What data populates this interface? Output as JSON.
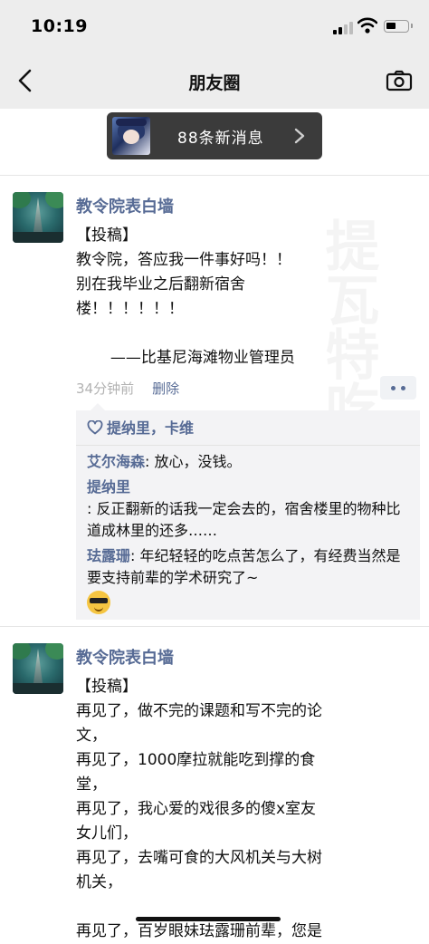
{
  "status_bar": {
    "time": "10:19"
  },
  "nav": {
    "title": "朋友圈"
  },
  "banner": {
    "text": "88条新消息"
  },
  "posts": [
    {
      "name": "教令院表白墙",
      "content": "【投稿】\n教令院，答应我一件事好吗！！\n别在我毕业之后翻新宿舍\n楼！！！！！！\n\n       ——比基尼海滩物业管理员",
      "time": "34分钟前",
      "delete_label": "删除",
      "likes": "提纳里，卡维",
      "comments": [
        {
          "user": "艾尔海森",
          "text": ": 放心，没钱。"
        },
        {
          "user": "提纳里",
          "text": ": 反正翻新的话我一定会去的，宿舍楼里的物种比道成林里的还多……"
        },
        {
          "user": "珐露珊",
          "text": ": 年纪轻轻的吃点苦怎么了，有经费当然是要支持前辈的学术研究了~"
        }
      ]
    },
    {
      "name": "教令院表白墙",
      "content": "【投稿】\n再见了，做不完的课题和写不完的论\n文，\n再见了，1000摩拉就能吃到撑的食\n堂，\n再见了，我心爱的戏很多的傻x室友\n女儿们，\n再见了，去嘴可食的大风机关与大树\n机关，\n\n再见了，百岁眼妹珐露珊前辈，您是"
    }
  ],
  "watermark": "提瓦特吃瓜实"
}
